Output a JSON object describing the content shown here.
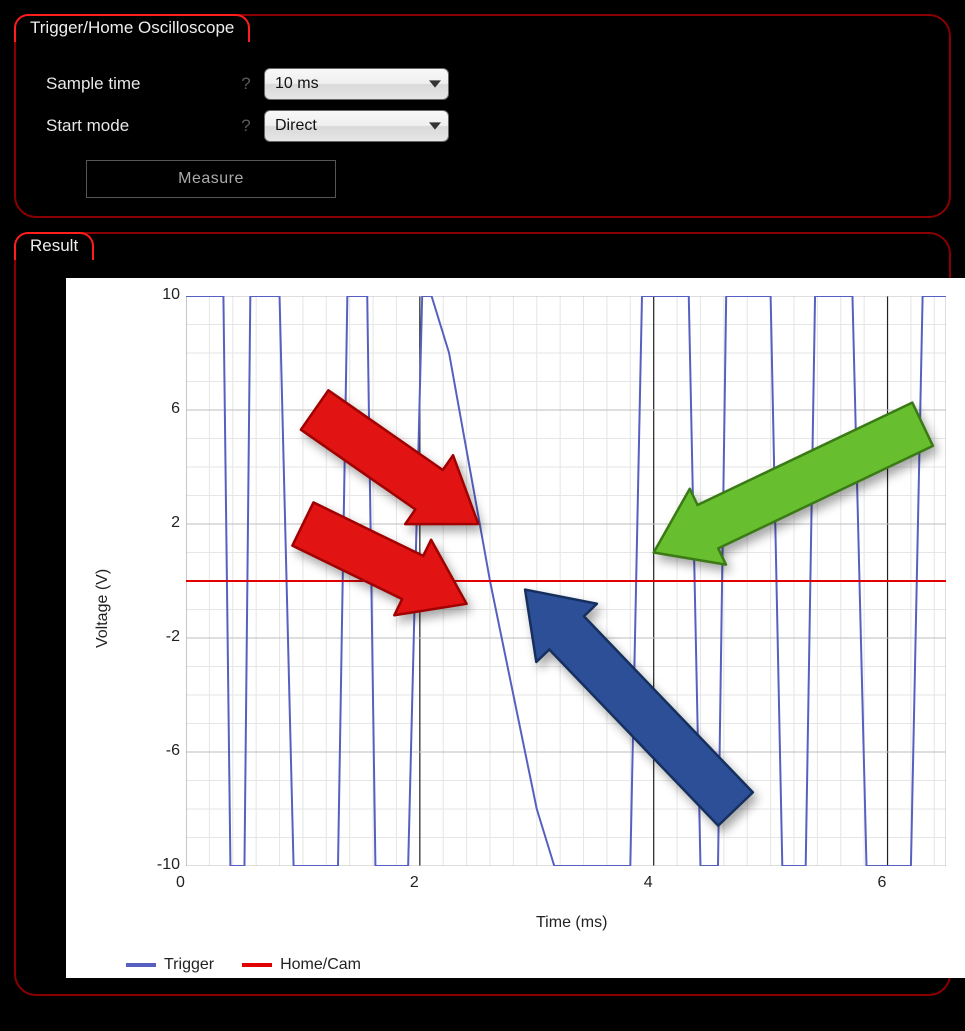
{
  "top_panel": {
    "title": "Trigger/Home Oscilloscope",
    "sample_time_label": "Sample time",
    "start_mode_label": "Start mode",
    "help_glyph": "?",
    "sample_time_value": "10 ms",
    "start_mode_value": "Direct",
    "measure_label": "Measure"
  },
  "result_panel": {
    "title": "Result"
  },
  "chart": {
    "ylabel": "Voltage (V)",
    "xlabel": "Time (ms)",
    "y_ticks": [
      "10",
      "6",
      "2",
      "-2",
      "-6",
      "-10"
    ],
    "x_ticks": [
      "0",
      "2",
      "4",
      "6"
    ],
    "legend": {
      "trigger_label": "Trigger",
      "homecam_label": "Home/Cam",
      "trigger_color": "#5760c0",
      "homecam_color": "#e00000"
    }
  },
  "colors": {
    "grid_minor": "#e6e6e6",
    "grid_major": "#bdbdbd",
    "axis": "#222222",
    "trigger_line": "#5760c0",
    "homecam_line": "#e00000",
    "arrow_red": "#e11313",
    "arrow_red_stroke": "#a00000",
    "arrow_blue": "#2d4f98",
    "arrow_blue_stroke": "#15305f",
    "arrow_green": "#67bf2f",
    "arrow_green_stroke": "#3a7a14"
  },
  "chart_data": {
    "type": "line",
    "xlabel": "Time (ms)",
    "ylabel": "Voltage (V)",
    "xlim": [
      0,
      6.5
    ],
    "ylim": [
      -10,
      10
    ],
    "series": [
      {
        "name": "Trigger",
        "color": "#5760c0",
        "note": "Near-square oscillation between ±10 V with narrow pulses; slow zero-crossing between ~2.2 and ~3.0 ms.",
        "x": [
          0.0,
          0.32,
          0.38,
          0.5,
          0.55,
          0.8,
          0.92,
          1.3,
          1.38,
          1.55,
          1.62,
          1.9,
          2.02,
          2.1,
          2.25,
          2.6,
          3.0,
          3.15,
          3.8,
          3.9,
          4.0,
          4.3,
          4.4,
          4.55,
          4.62,
          5.0,
          5.1,
          5.3,
          5.38,
          5.7,
          5.82,
          6.2,
          6.3,
          6.5
        ],
        "values": [
          10,
          10,
          -10,
          -10,
          10,
          10,
          -10,
          -10,
          10,
          10,
          -10,
          -10,
          10,
          10,
          8,
          0,
          -8,
          -10,
          -10,
          10,
          10,
          10,
          -10,
          -10,
          10,
          10,
          -10,
          -10,
          10,
          10,
          -10,
          -10,
          10,
          10
        ]
      },
      {
        "name": "Home/Cam",
        "color": "#e00000",
        "note": "Constant reference line at 0 V",
        "x": [
          0.0,
          6.5
        ],
        "values": [
          0,
          0
        ]
      }
    ],
    "annotations": [
      {
        "kind": "arrow",
        "color": "red",
        "from_xy": [
          1.1,
          6.0
        ],
        "to_xy": [
          2.5,
          2.0
        ]
      },
      {
        "kind": "arrow",
        "color": "red",
        "from_xy": [
          1.0,
          2.0
        ],
        "to_xy": [
          2.4,
          -0.8
        ]
      },
      {
        "kind": "arrow",
        "color": "blue",
        "from_xy": [
          4.7,
          -8.0
        ],
        "to_xy": [
          2.9,
          -0.3
        ]
      },
      {
        "kind": "arrow",
        "color": "green",
        "from_xy": [
          6.3,
          5.5
        ],
        "to_xy": [
          4.0,
          1.0
        ]
      }
    ]
  }
}
